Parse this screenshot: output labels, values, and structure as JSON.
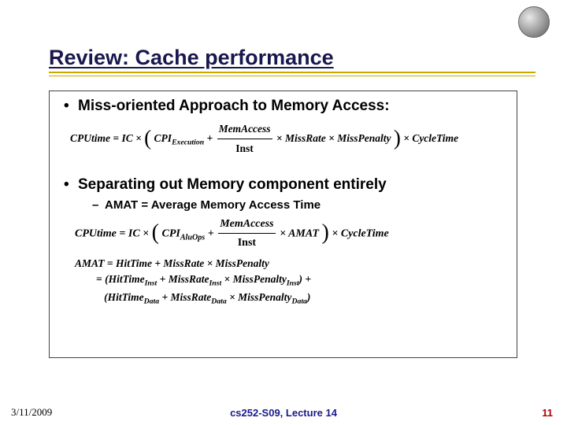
{
  "title": "Review: Cache performance",
  "bullets": {
    "b1": "Miss-oriented Approach to Memory Access:",
    "b2": "Separating out Memory component entirely",
    "b2_sub": "AMAT = Average Memory Access Time"
  },
  "eq1": {
    "lhs": "CPUtime",
    "ic": "IC",
    "cpi_exec": "CPI",
    "cpi_exec_sub": "Execution",
    "frac_num": "MemAccess",
    "frac_den": "Inst",
    "missrate": "MissRate",
    "misspen": "MissPenalty",
    "cycle": "CycleTime"
  },
  "eq2": {
    "lhs": "CPUtime",
    "ic": "IC",
    "cpi_alu": "CPI",
    "cpi_alu_sub": "AluOps",
    "frac_num": "MemAccess",
    "frac_den": "Inst",
    "amat": "AMAT",
    "cycle": "CycleTime"
  },
  "eq3": {
    "line1_lhs": "AMAT",
    "hit": "HitTime",
    "missrate": "MissRate",
    "misspen": "MissPenalty",
    "inst_sub": "Inst",
    "data_sub": "Data"
  },
  "footer": {
    "date": "3/11/2009",
    "center": "cs252-S09, Lecture 14",
    "page": "11"
  }
}
